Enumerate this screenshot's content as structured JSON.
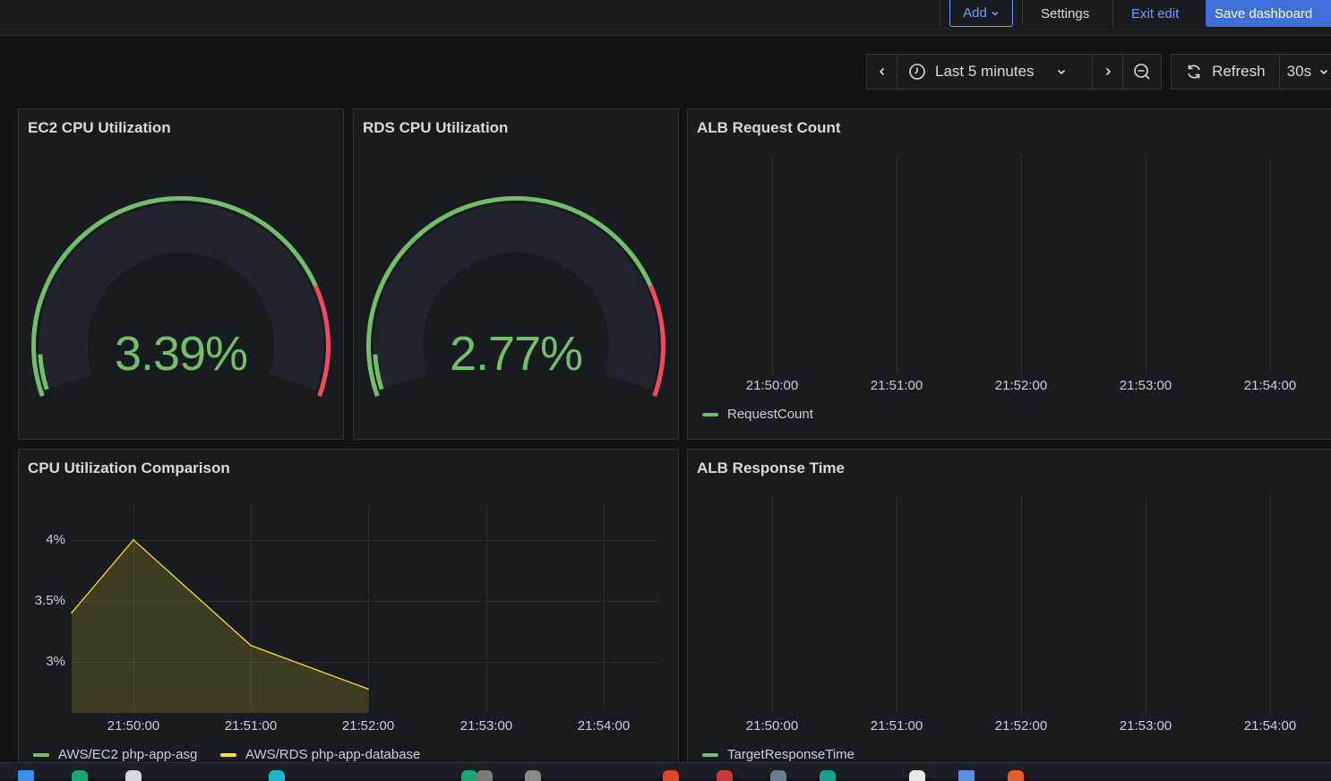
{
  "toolbar": {
    "add_label": "Add",
    "settings_label": "Settings",
    "exit_edit_label": "Exit edit",
    "save_label": "Save dashboard"
  },
  "time_controls": {
    "range_label": "Last 5 minutes",
    "refresh_label": "Refresh",
    "refresh_interval": "30s"
  },
  "panels": {
    "ec2_cpu": {
      "title": "EC2 CPU Utilization",
      "value": "3.39%",
      "value_fraction": 0.0339
    },
    "rds_cpu": {
      "title": "RDS CPU Utilization",
      "value": "2.77%",
      "value_fraction": 0.0277
    },
    "alb_request": {
      "title": "ALB Request Count",
      "x_ticks": [
        "21:50:00",
        "21:51:00",
        "21:52:00",
        "21:53:00",
        "21:54:00"
      ],
      "legend": "RequestCount"
    },
    "cpu_comparison": {
      "title": "CPU Utilization Comparison",
      "x_ticks": [
        "21:50:00",
        "21:51:00",
        "21:52:00",
        "21:53:00",
        "21:54:00"
      ],
      "y_ticks": [
        "4%",
        "3.5%",
        "3%"
      ],
      "legend": [
        "AWS/EC2 php-app-asg",
        "AWS/RDS php-app-database"
      ]
    },
    "alb_response": {
      "title": "ALB Response Time",
      "x_ticks": [
        "21:50:00",
        "21:51:00",
        "21:52:00",
        "21:53:00",
        "21:54:00"
      ],
      "legend": "TargetResponseTime"
    }
  },
  "colors": {
    "accent": "#6e9fff",
    "save_button": "#3d71d9",
    "gauge_value": "#73bf69",
    "threshold_green": "#73bf69",
    "threshold_red": "#f2495c",
    "series_ec2": "#73bf69",
    "series_rds": "#fade2a"
  },
  "chart_data": [
    {
      "type": "line",
      "title": "CPU Utilization Comparison",
      "x": [
        "21:49:28",
        "21:50:00",
        "21:51:00",
        "21:52:00"
      ],
      "series": [
        {
          "name": "AWS/RDS php-app-database",
          "values": [
            3.47,
            4.14,
            3.17,
            2.77
          ]
        },
        {
          "name": "AWS/EC2 php-app-asg",
          "values": []
        }
      ],
      "ylim": [
        2.55,
        4.55
      ],
      "y_ticks": [
        "4%",
        "3.5%",
        "3%"
      ],
      "x_ticks": [
        "21:50:00",
        "21:51:00",
        "21:52:00",
        "21:53:00",
        "21:54:00"
      ],
      "grid": true,
      "legend_placement": "bottom-left"
    },
    {
      "type": "line",
      "title": "ALB Request Count",
      "series": [
        {
          "name": "RequestCount",
          "values": []
        }
      ],
      "x_ticks": [
        "21:50:00",
        "21:51:00",
        "21:52:00",
        "21:53:00",
        "21:54:00"
      ],
      "grid": true,
      "legend_placement": "bottom-left"
    },
    {
      "type": "line",
      "title": "ALB Response Time",
      "series": [
        {
          "name": "TargetResponseTime",
          "values": []
        }
      ],
      "x_ticks": [
        "21:50:00",
        "21:51:00",
        "21:52:00",
        "21:53:00",
        "21:54:00"
      ],
      "grid": true,
      "legend_placement": "bottom-left"
    }
  ]
}
